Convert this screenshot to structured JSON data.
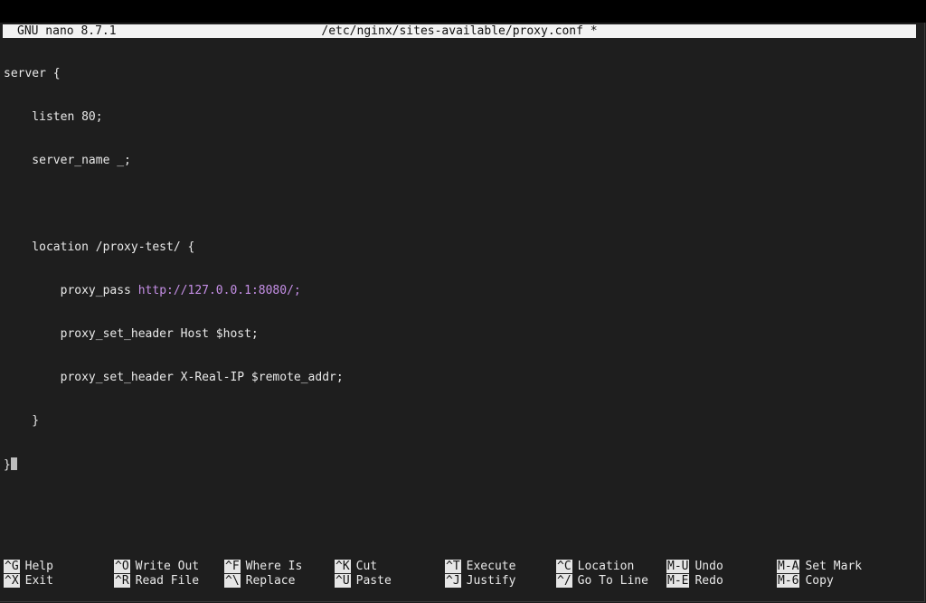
{
  "titlebar": {
    "app": "GNU nano 8.7.1",
    "file": "/etc/nginx/sites-available/proxy.conf *"
  },
  "editor": {
    "lines": [
      "server {",
      "    listen 80;",
      "    server_name _;",
      "",
      "    location /proxy-test/ {",
      "        proxy_pass ",
      "        proxy_set_header Host $host;",
      "        proxy_set_header X-Real-IP $remote_addr;",
      "    }",
      "}"
    ],
    "proxy_url": "http://127.0.0.1:8080/;"
  },
  "shortcuts": {
    "row1": [
      {
        "key": "^G",
        "label": "Help"
      },
      {
        "key": "^O",
        "label": "Write Out"
      },
      {
        "key": "^F",
        "label": "Where Is"
      },
      {
        "key": "^K",
        "label": "Cut"
      },
      {
        "key": "^T",
        "label": "Execute"
      },
      {
        "key": "^C",
        "label": "Location"
      },
      {
        "key": "M-U",
        "label": "Undo"
      },
      {
        "key": "M-A",
        "label": "Set Mark"
      }
    ],
    "row2": [
      {
        "key": "^X",
        "label": "Exit"
      },
      {
        "key": "^R",
        "label": "Read File"
      },
      {
        "key": "^\\",
        "label": "Replace"
      },
      {
        "key": "^U",
        "label": "Paste"
      },
      {
        "key": "^J",
        "label": "Justify"
      },
      {
        "key": "^/",
        "label": "Go To Line"
      },
      {
        "key": "M-E",
        "label": "Redo"
      },
      {
        "key": "M-6",
        "label": "Copy"
      }
    ]
  },
  "colors": {
    "background": "#1e1e1e",
    "titlebar": "#f2f2f2",
    "url": "#c58fe6",
    "key_badge": "#e6e6e6"
  }
}
